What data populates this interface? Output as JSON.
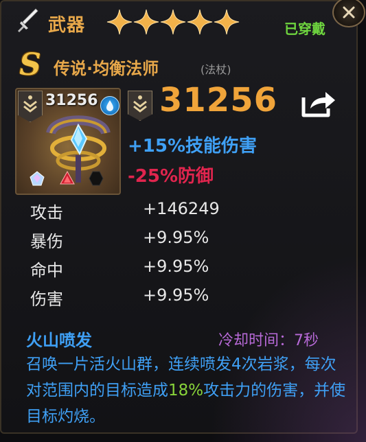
{
  "header": {
    "slot_label": "武器",
    "star_count": 5,
    "equipped_label": "已穿戴"
  },
  "item": {
    "grade_badge": "S",
    "name": "传说·均衡法师",
    "type": "(法杖)",
    "icon_power": "31256",
    "power": "31256"
  },
  "bonuses": [
    "+15%技能伤害",
    "-25%防御"
  ],
  "stats": [
    {
      "label": "攻击",
      "value": "+146249"
    },
    {
      "label": "暴伤",
      "value": "+9.95%"
    },
    {
      "label": "命中",
      "value": "+9.95%"
    },
    {
      "label": "伤害",
      "value": "+9.95%"
    }
  ],
  "skill": {
    "name": "火山喷发",
    "cooldown_label": "冷却时间：",
    "cooldown_value": "7秒",
    "desc_part1": "召唤一片活火山群，连续喷发4次岩浆，每次对范围内的目标造成",
    "desc_highlight": "18%",
    "desc_part2": "攻击力的伤害，并使目标灼烧。"
  },
  "colors": {
    "gold": "#e8a84a",
    "equipped_green": "#6fd63f",
    "buff_blue": "#3fa0f5",
    "debuff_red": "#e0254e",
    "cooldown_purple": "#b86ad8",
    "highlight_green": "#88d43a"
  },
  "icons": [
    "sword-icon",
    "star-icon",
    "close-icon",
    "rank-chevron-icon",
    "water-drop-icon",
    "share-icon",
    "staff-item-icon",
    "gem-icon"
  ]
}
